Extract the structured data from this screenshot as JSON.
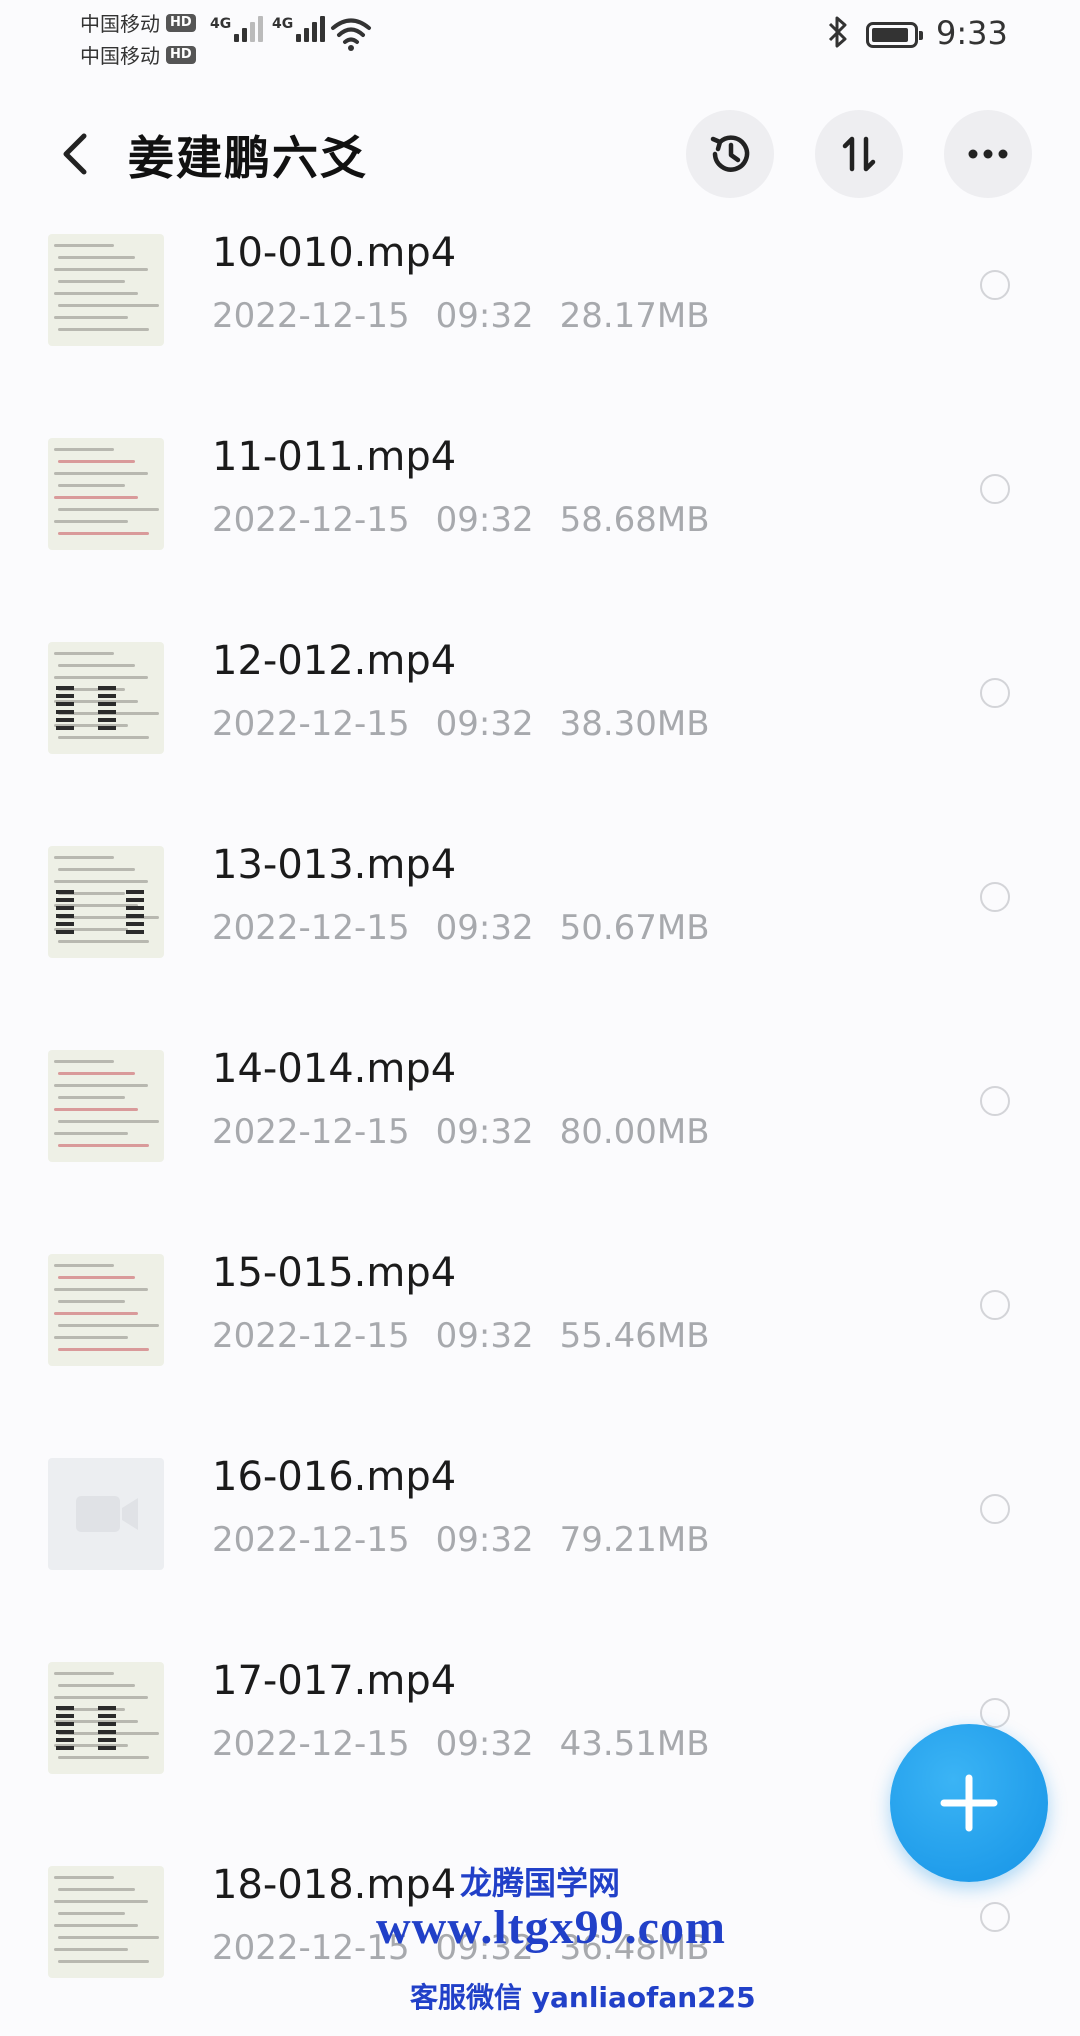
{
  "status_bar": {
    "carrier_1": "中国移动",
    "carrier_2": "中国移动",
    "hd_badge": "HD",
    "network_1": "4G",
    "network_2": "4G",
    "time": "9:33",
    "battery_level": 0.9
  },
  "header": {
    "title": "姜建鹏六爻",
    "back_icon": "chevron-left-icon",
    "actions": [
      {
        "name": "history",
        "icon": "history-icon"
      },
      {
        "name": "sort",
        "icon": "sort-icon"
      },
      {
        "name": "more",
        "icon": "more-icon"
      }
    ]
  },
  "files": [
    {
      "name": "10-010.mp4",
      "date": "2022-12-15",
      "time": "09:32",
      "size": "28.17MB"
    },
    {
      "name": "11-011.mp4",
      "date": "2022-12-15",
      "time": "09:32",
      "size": "58.68MB"
    },
    {
      "name": "12-012.mp4",
      "date": "2022-12-15",
      "time": "09:32",
      "size": "38.30MB"
    },
    {
      "name": "13-013.mp4",
      "date": "2022-12-15",
      "time": "09:32",
      "size": "50.67MB"
    },
    {
      "name": "14-014.mp4",
      "date": "2022-12-15",
      "time": "09:32",
      "size": "80.00MB"
    },
    {
      "name": "15-015.mp4",
      "date": "2022-12-15",
      "time": "09:32",
      "size": "55.46MB"
    },
    {
      "name": "16-016.mp4",
      "date": "2022-12-15",
      "time": "09:32",
      "size": "79.21MB"
    },
    {
      "name": "17-017.mp4",
      "date": "2022-12-15",
      "time": "09:32",
      "size": "43.51MB"
    },
    {
      "name": "18-018.mp4",
      "date": "2022-12-15",
      "time": "09:32",
      "size": "36.48MB"
    }
  ],
  "fab": {
    "icon": "plus-icon"
  },
  "watermark": {
    "line1": "龙腾国学网",
    "line2": "www.ltgx99.com",
    "line3": "客服微信 yanliaofan225"
  },
  "colors": {
    "accent": "#1593e6",
    "meta_text": "#a7a9ad",
    "watermark": "#2140c8"
  }
}
